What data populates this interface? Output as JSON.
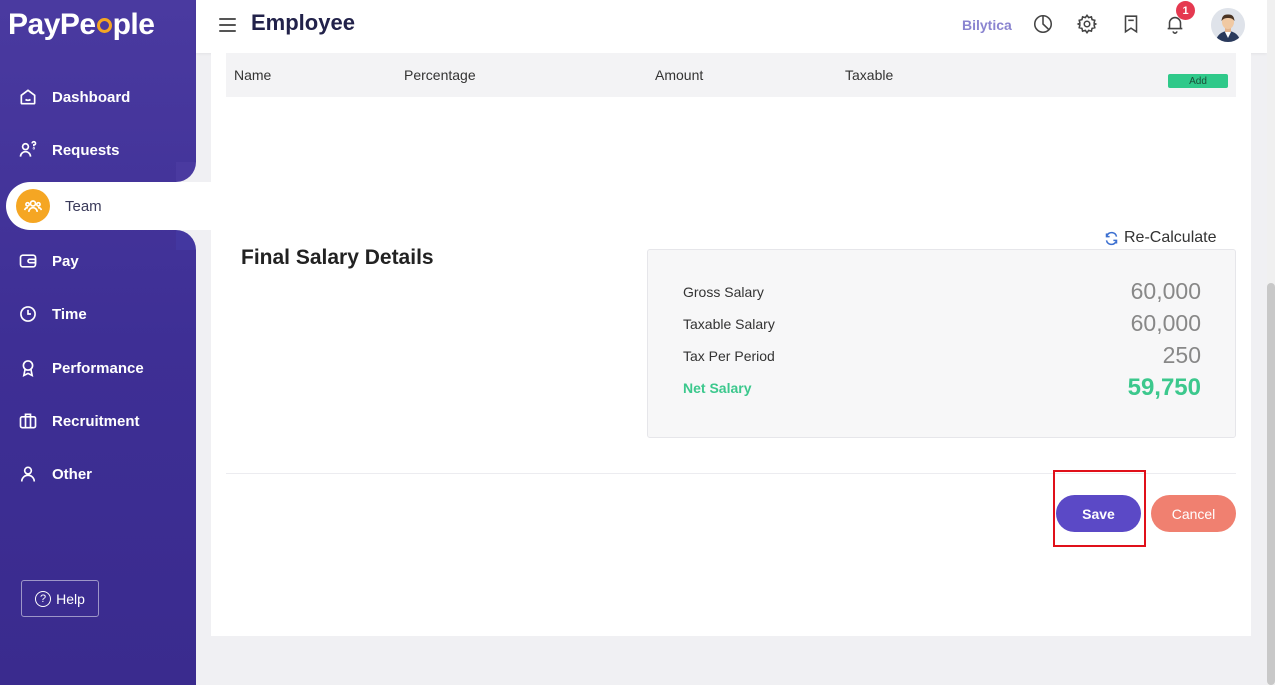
{
  "brand": {
    "logo_pre": "PayPe",
    "logo_post": "ple"
  },
  "sidebar": {
    "items": [
      {
        "label": "Dashboard"
      },
      {
        "label": "Requests"
      },
      {
        "label": "Team"
      },
      {
        "label": "Pay"
      },
      {
        "label": "Time"
      },
      {
        "label": "Performance"
      },
      {
        "label": "Recruitment"
      },
      {
        "label": "Other"
      }
    ],
    "help_label": "Help"
  },
  "header": {
    "title": "Employee",
    "company": "Bilytica",
    "notification_count": "1"
  },
  "table": {
    "columns": [
      "Name",
      "Percentage",
      "Amount",
      "Taxable"
    ],
    "add_label": "Add"
  },
  "final_salary": {
    "title": "Final Salary Details",
    "recalculate_label": "Re-Calculate",
    "rows": [
      {
        "label": "Gross Salary",
        "value": "60,000"
      },
      {
        "label": "Taxable Salary",
        "value": "60,000"
      },
      {
        "label": "Tax Per Period",
        "value": "250"
      },
      {
        "label": "Net Salary",
        "value": "59,750"
      }
    ]
  },
  "actions": {
    "save_label": "Save",
    "cancel_label": "Cancel"
  },
  "colors": {
    "sidebar": "#3e2f95",
    "accent": "#5b49c6",
    "active_icon": "#f5a623",
    "net_salary": "#3cc88d",
    "cancel": "#f08070",
    "add": "#2fc98a"
  }
}
